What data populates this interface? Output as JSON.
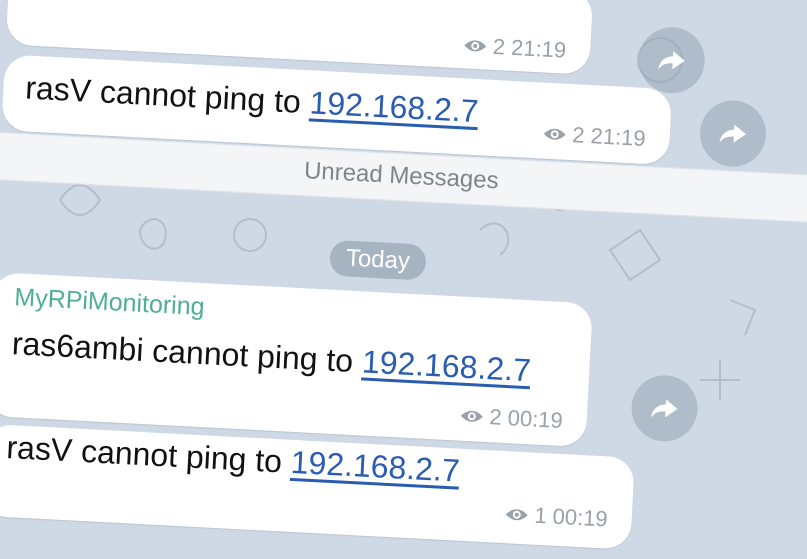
{
  "messages": [
    {
      "text": "",
      "link": "",
      "views": "2",
      "time": "21:19"
    },
    {
      "text": "rasV cannot ping to ",
      "link": "192.168.2.7",
      "views": "2",
      "time": "21:19"
    },
    {
      "sender": "MyRPiMonitoring",
      "text": "ras6ambi cannot ping to ",
      "link": "192.168.2.7",
      "views": "2",
      "time": "00:19"
    },
    {
      "text": "rasV cannot ping to ",
      "link": "192.168.2.7",
      "views": "1",
      "time": "00:19"
    }
  ],
  "separator": {
    "unread_label": "Unread Messages"
  },
  "date_label": "Today",
  "icons": {
    "views": "eye-icon",
    "forward": "forward-arrow-icon"
  },
  "colors": {
    "sender": "#4fae97",
    "link": "#2a5db0",
    "background": "#cfd9e5"
  }
}
